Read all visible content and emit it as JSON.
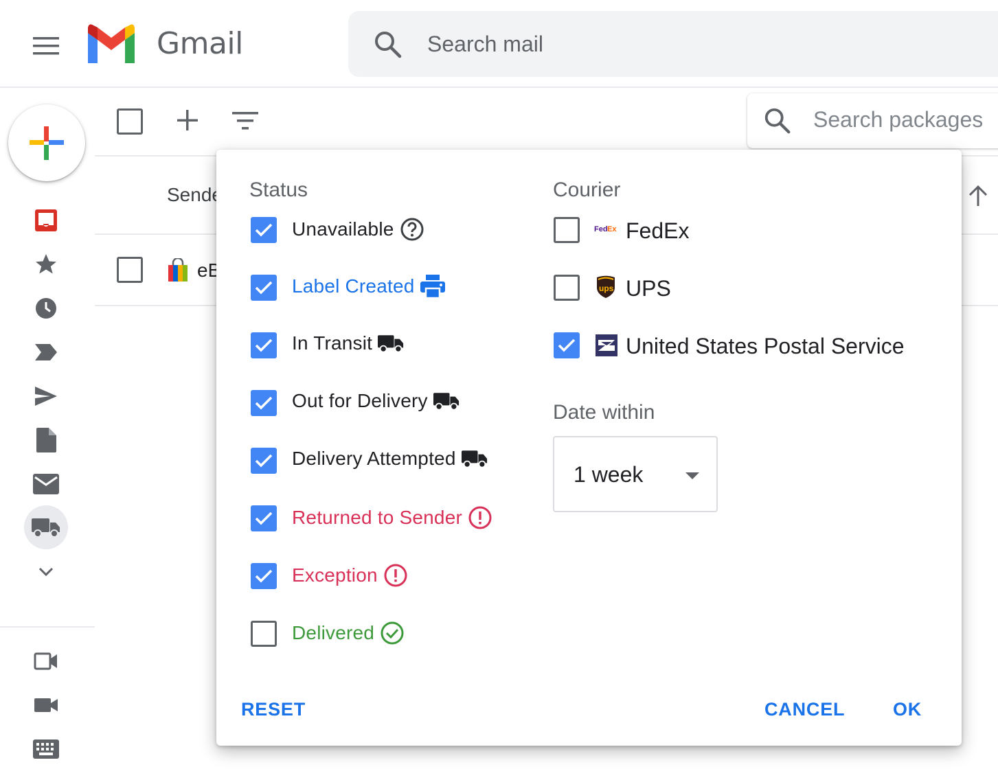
{
  "header": {
    "app_name": "Gmail",
    "search_placeholder": "Search mail"
  },
  "toolbar": {
    "package_search_placeholder": "Search packages"
  },
  "list": {
    "column_sender": "Sende",
    "rows": [
      {
        "sender": "eB"
      }
    ]
  },
  "filter_dialog": {
    "status_title": "Status",
    "status_options": [
      {
        "label": "Unavailable",
        "checked": true,
        "icon": "help-circle-icon",
        "color": "#202124"
      },
      {
        "label": "Label Created",
        "checked": true,
        "icon": "printer-icon",
        "color": "#1a73e8"
      },
      {
        "label": "In Transit",
        "checked": true,
        "icon": "truck-icon",
        "color": "#202124"
      },
      {
        "label": "Out for Delivery",
        "checked": true,
        "icon": "truck-icon",
        "color": "#202124"
      },
      {
        "label": "Delivery Attempted",
        "checked": true,
        "icon": "truck-icon",
        "color": "#202124"
      },
      {
        "label": "Returned to Sender",
        "checked": true,
        "icon": "alert-circle-icon",
        "color": "#d93057"
      },
      {
        "label": "Exception",
        "checked": true,
        "icon": "alert-circle-icon",
        "color": "#d93057"
      },
      {
        "label": "Delivered",
        "checked": false,
        "icon": "check-circle-icon",
        "color": "#3d9a3b"
      }
    ],
    "courier_title": "Courier",
    "courier_options": [
      {
        "label": "FedEx",
        "checked": false,
        "icon": "fedex-logo"
      },
      {
        "label": "UPS",
        "checked": false,
        "icon": "ups-logo"
      },
      {
        "label": "United States Postal Service",
        "checked": true,
        "icon": "usps-logo"
      }
    ],
    "date_title": "Date within",
    "date_value": "1 week",
    "reset_label": "RESET",
    "cancel_label": "CANCEL",
    "ok_label": "OK"
  },
  "colors": {
    "accent": "#1a73e8",
    "checkbox": "#4285f4",
    "error": "#d93057",
    "success": "#3d9a3b"
  }
}
